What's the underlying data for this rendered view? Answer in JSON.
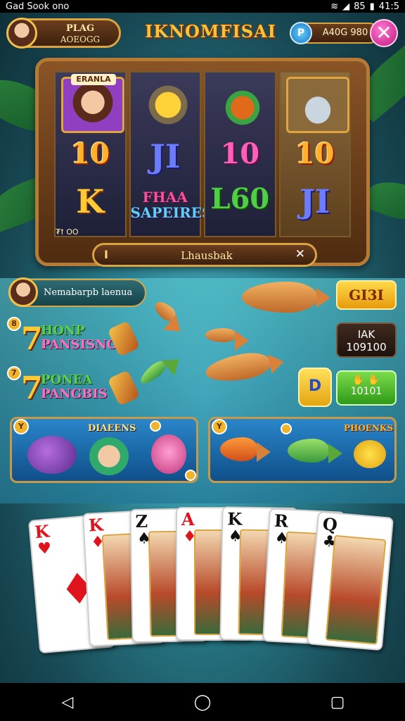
{
  "status_bar": {
    "left_text": "Gad Sook ono",
    "right_text": "85",
    "time": "41:5",
    "icons": [
      "signal-icon",
      "wifi-icon",
      "battery-icon"
    ]
  },
  "header": {
    "player_name": "PLAG",
    "player_sub": "AOEOGG",
    "title": "IKNOMFISAI",
    "coin_symbol": "P",
    "coin_amount": "A40G 980",
    "close_symbol": "✕"
  },
  "slot": {
    "reels": [
      {
        "top_label": "ERANLA",
        "row2": "10",
        "row3": "K",
        "picture": "woman-portrait"
      },
      {
        "row2": "JI",
        "row3_line1": "FHAA",
        "row3_line2": "SAPEIRES",
        "picture": "sun-creature"
      },
      {
        "row2": "10",
        "row3": "L60",
        "picture": "fruit-icon"
      },
      {
        "row2": "10",
        "row3": "JI",
        "picture": "fish-with-hat"
      }
    ],
    "reel_footer": "₮ꝉ  OO",
    "spin_minus": "I",
    "spin_label": "Lhausbak",
    "spin_plus": "✕"
  },
  "middle": {
    "jackpot_text": "Nemabarpb laenua",
    "feature1": {
      "badge": "8",
      "number": "7",
      "line1": "HONP",
      "line2": "PANSISNG"
    },
    "feature2": {
      "badge": "7",
      "number": "7",
      "line1": "PONEA",
      "line2": "PANGBIS"
    },
    "btn_top": "GI3I",
    "btn_mid_line1": "IAK",
    "btn_mid_line2": "109100",
    "btn_small": "D",
    "btn_green_line1": "",
    "btn_green_line2": "10101"
  },
  "panels": {
    "left": {
      "badge": "Y",
      "title": "DIAEENS"
    },
    "right": {
      "badge": "Y",
      "title": "PHOENKS"
    }
  },
  "cards": [
    {
      "rank": "K",
      "suit": "♥",
      "color": "red"
    },
    {
      "rank": "K",
      "suit": "♦",
      "color": "red"
    },
    {
      "rank": "Z",
      "suit": "♠",
      "color": "black"
    },
    {
      "rank": "A",
      "suit": "♦",
      "color": "red"
    },
    {
      "rank": "K",
      "suit": "♠",
      "color": "black"
    },
    {
      "rank": "R",
      "suit": "♠",
      "color": "black"
    },
    {
      "rank": "Q",
      "suit": "♣",
      "color": "black"
    }
  ],
  "navbar": {
    "back": "◁",
    "home": "◯",
    "recent": "▢"
  },
  "colors": {
    "gold": "#d9a441",
    "wood": "#6b3d1d",
    "water": "#4fb7c7",
    "magenta": "#c0157d"
  }
}
